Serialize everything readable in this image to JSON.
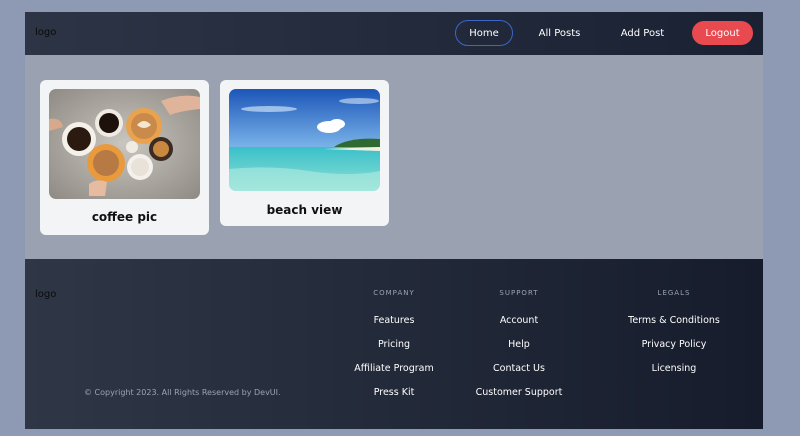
{
  "header": {
    "logo": "logo",
    "nav": {
      "home": "Home",
      "all_posts": "All Posts",
      "add_post": "Add Post",
      "logout": "Logout"
    },
    "colors": {
      "active_border": "#3b67c8",
      "logout_bg": "#e84a4f"
    }
  },
  "posts": [
    {
      "title": "coffee pic",
      "image": "coffee-cups-photo"
    },
    {
      "title": "beach view",
      "image": "tropical-beach-photo"
    }
  ],
  "footer": {
    "logo": "logo",
    "copyright": "© Copyright 2023. All Rights Reserved by DevUI.",
    "company": {
      "heading": "COMPANY",
      "links": [
        "Features",
        "Pricing",
        "Affiliate Program",
        "Press Kit"
      ]
    },
    "support": {
      "heading": "SUPPORT",
      "links": [
        "Account",
        "Help",
        "Contact Us",
        "Customer Support"
      ]
    },
    "legals": {
      "heading": "LEGALS",
      "links": [
        "Terms & Conditions",
        "Privacy Policy",
        "Licensing"
      ]
    }
  }
}
